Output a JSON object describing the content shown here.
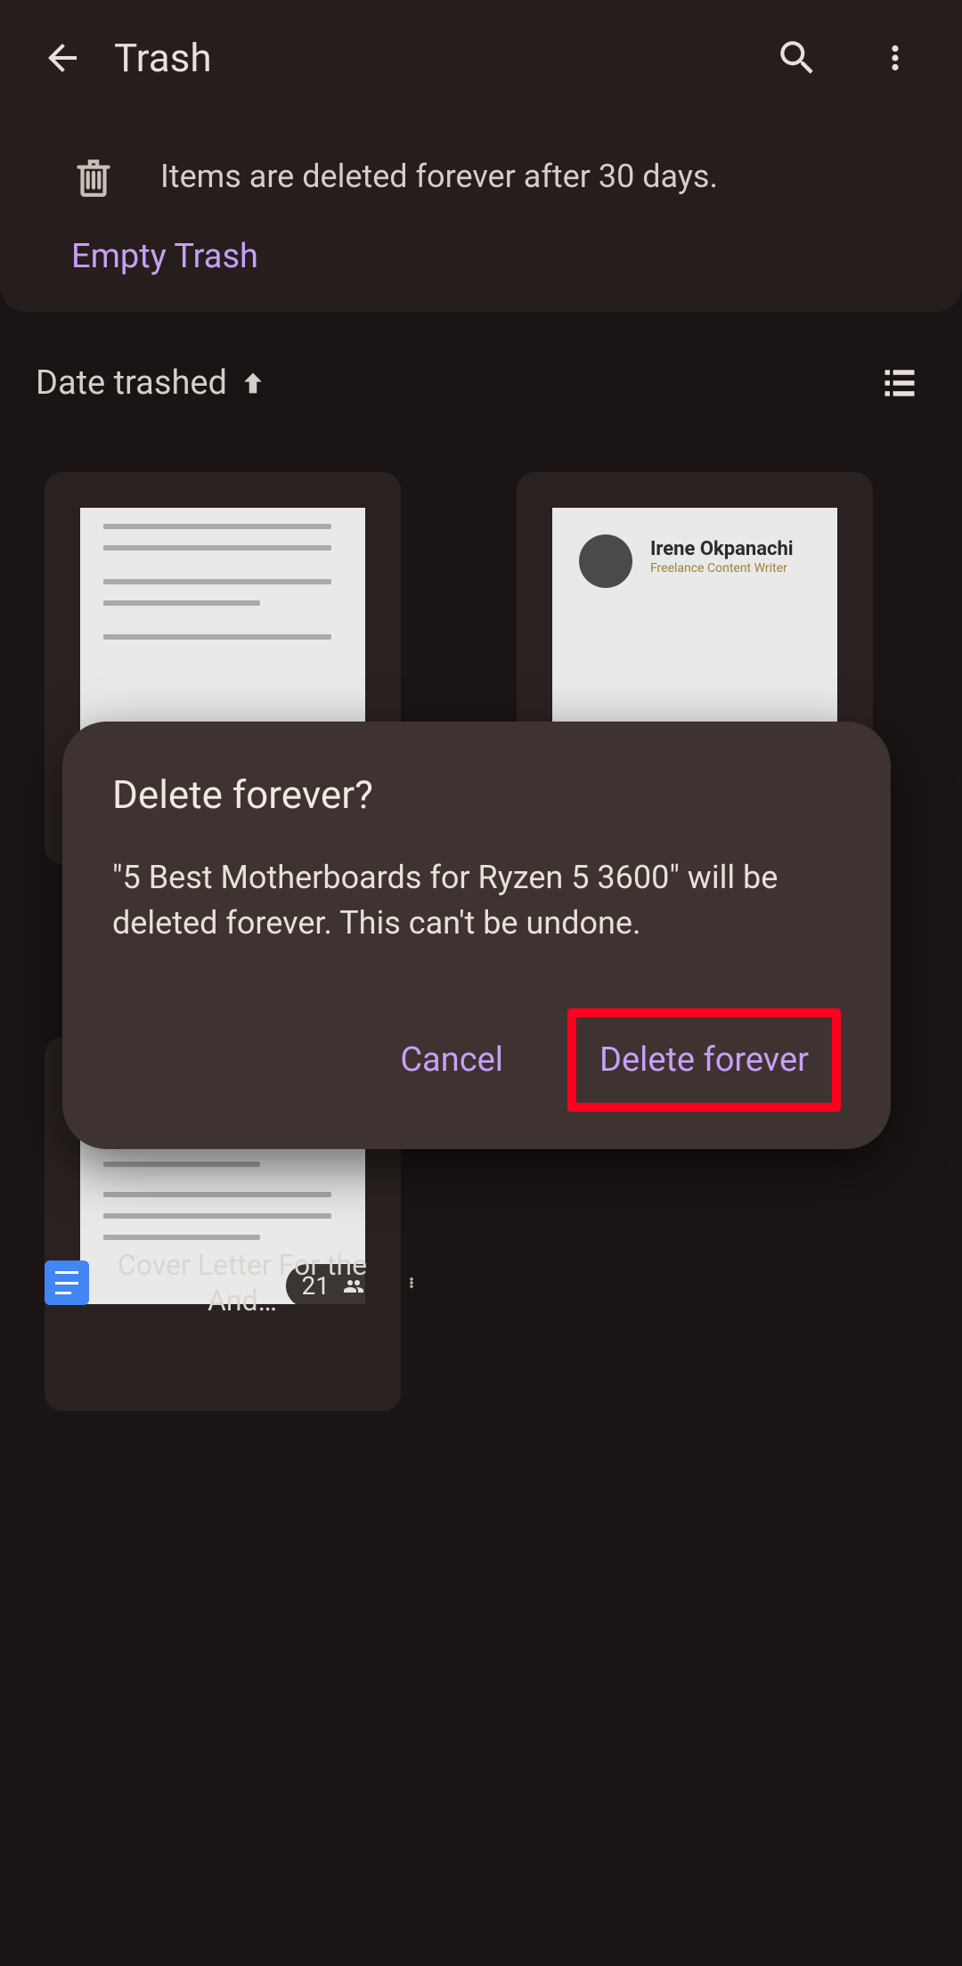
{
  "header": {
    "title": "Trash"
  },
  "banner": {
    "info_text": "Items are deleted forever after 30 days.",
    "empty_label": "Empty Trash"
  },
  "sort": {
    "label": "Date trashed"
  },
  "files": [
    {
      "title": "5 Best Motherboards for Ryzen 5 3600",
      "type": "doc"
    },
    {
      "title": "Irene Okpanachi",
      "subtitle": "Freelance Content Writer",
      "type": "doc"
    },
    {
      "title": "Cover Letter For the And…",
      "type": "doc",
      "shared_count": "21"
    }
  ],
  "dialog": {
    "title": "Delete forever?",
    "body": "\"5 Best Motherboards for Ryzen 5 3600\" will be deleted forever. This can't be undone.",
    "cancel_label": "Cancel",
    "confirm_label": "Delete forever"
  }
}
